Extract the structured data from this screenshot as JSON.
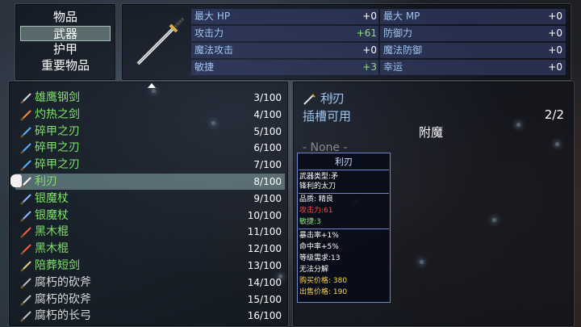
{
  "categories": [
    {
      "label": "物品"
    },
    {
      "label": "武器"
    },
    {
      "label": "护甲"
    },
    {
      "label": "重要物品"
    }
  ],
  "selected_category": 1,
  "stats": {
    "left": [
      {
        "label": "最大 HP",
        "value": "+0",
        "positive": false
      },
      {
        "label": "攻击力",
        "value": "+61",
        "positive": true
      },
      {
        "label": "魔法攻击",
        "value": "+0",
        "positive": false
      },
      {
        "label": "敏捷",
        "value": "+3",
        "positive": true
      }
    ],
    "right": [
      {
        "label": "最大 MP",
        "value": "+0"
      },
      {
        "label": "防御力",
        "value": "+0"
      },
      {
        "label": "魔法防御",
        "value": "+0"
      },
      {
        "label": "幸运",
        "value": "+0"
      }
    ]
  },
  "items": [
    {
      "name": "雄鹰钢剑",
      "qty": "3/100",
      "icon": "sword-icon",
      "grey": false
    },
    {
      "name": "灼热之剑",
      "qty": "4/100",
      "icon": "fire-sword-icon",
      "grey": false
    },
    {
      "name": "碎甲之刃",
      "qty": "5/100",
      "icon": "blade-icon",
      "grey": false
    },
    {
      "name": "碎甲之刃",
      "qty": "6/100",
      "icon": "blade-icon",
      "grey": false
    },
    {
      "name": "碎甲之刃",
      "qty": "7/100",
      "icon": "blade-icon",
      "grey": false
    },
    {
      "name": "利刃",
      "qty": "8/100",
      "icon": "katana-icon",
      "grey": false
    },
    {
      "name": "银魔杖",
      "qty": "9/100",
      "icon": "wand-icon",
      "grey": false
    },
    {
      "name": "银魔杖",
      "qty": "10/100",
      "icon": "wand-icon",
      "grey": false
    },
    {
      "name": "黑木棍",
      "qty": "11/100",
      "icon": "staff-icon",
      "grey": false
    },
    {
      "name": "黑木棍",
      "qty": "12/100",
      "icon": "staff-icon",
      "grey": false
    },
    {
      "name": "陪葬短剑",
      "qty": "13/100",
      "icon": "dagger-icon",
      "grey": false
    },
    {
      "name": "腐朽的砍斧",
      "qty": "14/100",
      "icon": "axe-icon",
      "grey": true
    },
    {
      "name": "腐朽的砍斧",
      "qty": "15/100",
      "icon": "axe-icon",
      "grey": true
    },
    {
      "name": "腐朽的长弓",
      "qty": "16/100",
      "icon": "bow-icon",
      "grey": true
    }
  ],
  "selected_item": 5,
  "detail": {
    "title": "利刃",
    "slot_label": "插槽可用",
    "slot_count": "2/2",
    "enchant_label": "附魔",
    "none_label": "- None -"
  },
  "tooltip": {
    "title": "利刃",
    "type": "武器类型:矛",
    "desc": "锋利的太刀",
    "quality": "品质: 精良",
    "attack": "攻击力:61",
    "agility": "敏捷:3",
    "crit": "暴击率+1%",
    "hit": "命中率+5%",
    "level": "等级需求:13",
    "unbreak": "无法分解",
    "buy": "购买价格: 380",
    "sell": "出售价格: 190"
  },
  "colors": {
    "list_green": "#7fe26a",
    "stat_label": "#9dc4ef",
    "attack_red": "#ff4d4d",
    "price_yellow": "#ffd84a"
  }
}
